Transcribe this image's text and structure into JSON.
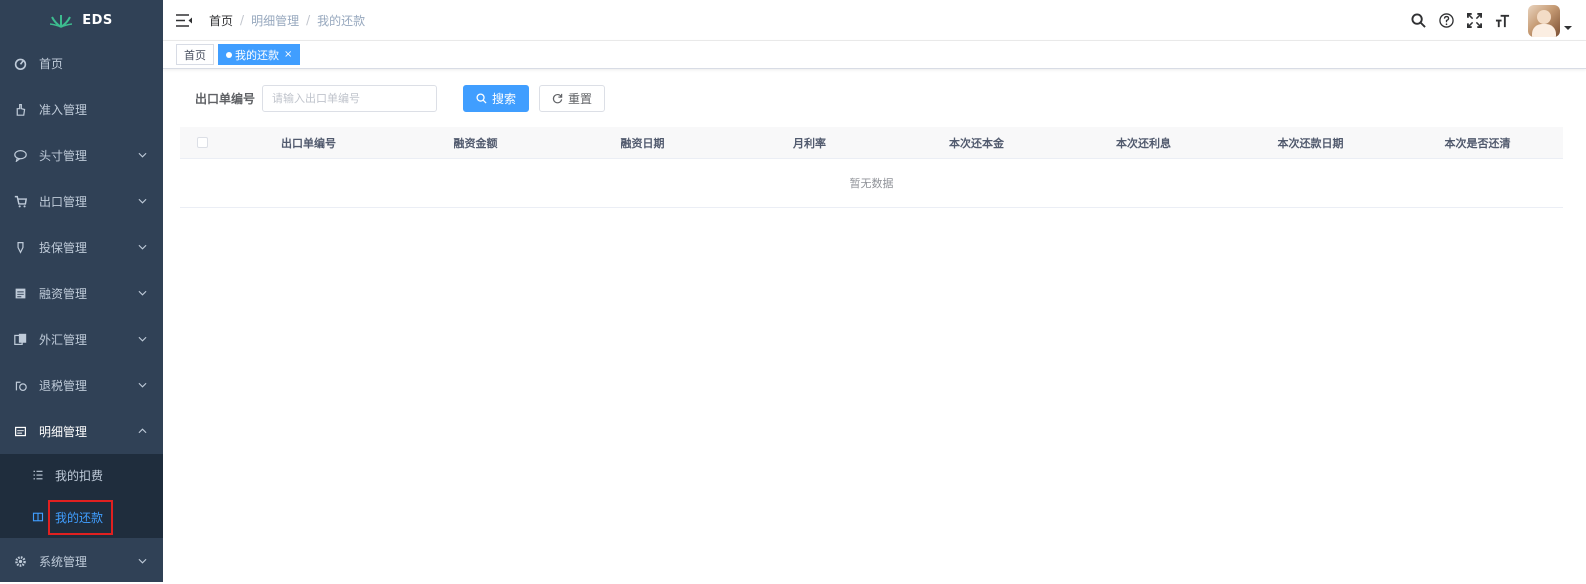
{
  "app": {
    "logo_text": "EDS"
  },
  "sidebar": {
    "items": [
      {
        "label": "首页",
        "icon": "dashboard-icon",
        "has_arrow": false
      },
      {
        "label": "准入管理",
        "icon": "hand-icon",
        "has_arrow": false
      },
      {
        "label": "头寸管理",
        "icon": "chat-icon",
        "has_arrow": true
      },
      {
        "label": "出口管理",
        "icon": "cart-icon",
        "has_arrow": true
      },
      {
        "label": "投保管理",
        "icon": "pin-icon",
        "has_arrow": true
      },
      {
        "label": "融资管理",
        "icon": "document-icon",
        "has_arrow": true
      },
      {
        "label": "外汇管理",
        "icon": "exchange-icon",
        "has_arrow": true
      },
      {
        "label": "退税管理",
        "icon": "tax-icon",
        "has_arrow": true
      },
      {
        "label": "明细管理",
        "icon": "detail-icon",
        "has_arrow": true,
        "open": true
      },
      {
        "label": "系统管理",
        "icon": "gear-icon",
        "has_arrow": true
      }
    ],
    "sub_items": [
      {
        "label": "我的扣费",
        "icon": "list-icon",
        "active": false
      },
      {
        "label": "我的还款",
        "icon": "book-icon",
        "active": true
      }
    ]
  },
  "navbar": {
    "breadcrumb": [
      "首页",
      "明细管理",
      "我的还款"
    ]
  },
  "tags": [
    {
      "label": "首页",
      "active": false
    },
    {
      "label": "我的还款",
      "active": true
    }
  ],
  "search": {
    "label": "出口单编号",
    "placeholder": "请输入出口单编号",
    "value": "",
    "search_button": "搜索",
    "reset_button": "重置"
  },
  "table": {
    "columns": [
      "出口单编号",
      "融资金额",
      "融资日期",
      "月利率",
      "本次还本金",
      "本次还利息",
      "本次还款日期",
      "本次是否还清"
    ],
    "empty_text": "暂无数据"
  },
  "colors": {
    "sidebar_bg": "#304156",
    "submenu_bg": "#1f2d3d",
    "accent": "#409eff",
    "highlight_border": "#e02020"
  }
}
